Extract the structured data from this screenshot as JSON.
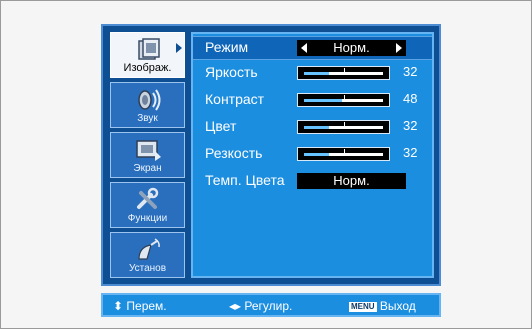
{
  "sidebar": {
    "items": [
      {
        "label": "Изображ.",
        "icon": "picture-icon",
        "active": true
      },
      {
        "label": "Звук",
        "icon": "sound-icon",
        "active": false
      },
      {
        "label": "Экран",
        "icon": "screen-icon",
        "active": false
      },
      {
        "label": "Функции",
        "icon": "tools-icon",
        "active": false
      },
      {
        "label": "Установ",
        "icon": "antenna-icon",
        "active": false
      }
    ]
  },
  "picture_menu": {
    "mode": {
      "label": "Режим",
      "value": "Норм."
    },
    "brightness": {
      "label": "Яркость",
      "value": "32",
      "level": 0.32
    },
    "contrast": {
      "label": "Контраст",
      "value": "48",
      "level": 0.48
    },
    "color": {
      "label": "Цвет",
      "value": "32",
      "level": 0.32
    },
    "sharpness": {
      "label": "Резкость",
      "value": "32",
      "level": 0.32
    },
    "color_temp": {
      "label": "Темп. Цвета",
      "value": "Норм."
    }
  },
  "footer": {
    "move_label": "Перем.",
    "adjust_label": "Регулир.",
    "menu_key": "MENU",
    "exit_label": "Выход"
  },
  "colors": {
    "osd_bg": "#0e4f94",
    "panel_bg": "#1c8ee0",
    "selected_row": "#0f65b8",
    "bar_fill": "#67c3ff"
  }
}
